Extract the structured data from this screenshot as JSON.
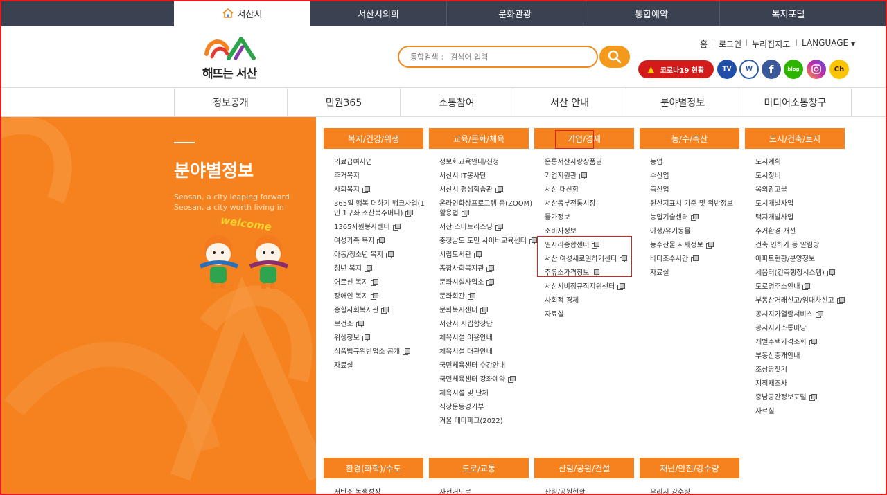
{
  "top_tabs": [
    "서산시",
    "서산시의회",
    "문화관광",
    "통합예약",
    "복지포털"
  ],
  "logo": {
    "text": "해뜨는 서산"
  },
  "search": {
    "label": "통합검색",
    "placeholder": "검색어 입력"
  },
  "utility_links": [
    "홈",
    "로그인",
    "누리집지도",
    "LANGUAGE"
  ],
  "corona_badge": "코로나19 현황",
  "sns": [
    {
      "name": "서산시TV",
      "color": "#1f4fa8"
    },
    {
      "name": "서산시 블로그웹진",
      "color": "#2a5caa"
    },
    {
      "name": "facebook",
      "color": "#3b5998"
    },
    {
      "name": "blog",
      "color": "#2db400"
    },
    {
      "name": "instagram",
      "color": "#c32aa3"
    },
    {
      "name": "kakao channel",
      "color": "#fbc400"
    }
  ],
  "main_nav": [
    "정보공개",
    "민원365",
    "소통참여",
    "서산 안내",
    "분야별정보",
    "미디어소통창구"
  ],
  "left_panel": {
    "title": "분야별정보",
    "sub1": "Seosan, a city leaping forward",
    "sub2": "Seosan, a city worth living in",
    "welcome": "welcome"
  },
  "columns": [
    {
      "title": "복지/건강/위생",
      "items": [
        {
          "t": "의료급여사업",
          "e": false
        },
        {
          "t": "주거복지",
          "e": false
        },
        {
          "t": "사회복지",
          "e": true
        },
        {
          "t": "365일 행복 더하기 뱅크사업(1인 1구좌 소산복주머니)",
          "e": true
        },
        {
          "t": "1365자원봉사센터",
          "e": true
        },
        {
          "t": "여성가족 복지",
          "e": true
        },
        {
          "t": "아동/청소년 복지",
          "e": true
        },
        {
          "t": "청년 복지",
          "e": true
        },
        {
          "t": "어르신 복지",
          "e": true
        },
        {
          "t": "장애인 복지",
          "e": true
        },
        {
          "t": "종합사회복지관",
          "e": true
        },
        {
          "t": "보건소",
          "e": true
        },
        {
          "t": "위생정보",
          "e": true
        },
        {
          "t": "식품법규위반업소 공개",
          "e": true
        },
        {
          "t": "자료실",
          "e": false
        }
      ]
    },
    {
      "title": "교육/문화/체육",
      "items": [
        {
          "t": "정보화교육안내/신청",
          "e": false
        },
        {
          "t": "서산시 IT봉사단",
          "e": false
        },
        {
          "t": "서산시 평생학습관",
          "e": true
        },
        {
          "t": "온라인화상프로그램 줌(ZOOM)활용법",
          "e": true
        },
        {
          "t": "서산 스마트리스닝",
          "e": true
        },
        {
          "t": "충청남도 도민 사이버교육센터",
          "e": true
        },
        {
          "t": "시립도서관",
          "e": true
        },
        {
          "t": "종합사회복지관",
          "e": true
        },
        {
          "t": "문화시설사업소",
          "e": true
        },
        {
          "t": "문화회관",
          "e": true
        },
        {
          "t": "문화복지센터",
          "e": true
        },
        {
          "t": "서산시 시립합창단",
          "e": false
        },
        {
          "t": "체육시설 이용안내",
          "e": false
        },
        {
          "t": "체육시설 대관안내",
          "e": false
        },
        {
          "t": "국민체육센터 수강안내",
          "e": false
        },
        {
          "t": "국민체육센터 강좌예약",
          "e": true
        },
        {
          "t": "체육시설 및 단체",
          "e": false
        },
        {
          "t": "직장운동경기부",
          "e": false
        },
        {
          "t": "겨울 테마파크(2022)",
          "e": false
        }
      ]
    },
    {
      "title": "기업/경제",
      "items": [
        {
          "t": "온통서산사랑상품권",
          "e": false
        },
        {
          "t": "기업지원관",
          "e": true
        },
        {
          "t": "서산 대산항",
          "e": false
        },
        {
          "t": "서산동부전통시장",
          "e": false
        },
        {
          "t": "물가정보",
          "e": false
        },
        {
          "t": "소비자정보",
          "e": false
        },
        {
          "t": "일자리종합센터",
          "e": true
        },
        {
          "t": "서산 여성새로일하기센터",
          "e": true
        },
        {
          "t": "주유소가격정보",
          "e": true
        },
        {
          "t": "서산시비정규직지원센터",
          "e": true
        },
        {
          "t": "사회적 경제",
          "e": false
        },
        {
          "t": "자료실",
          "e": false
        }
      ]
    },
    {
      "title": "농/수/축산",
      "items": [
        {
          "t": "농업",
          "e": false
        },
        {
          "t": "수산업",
          "e": false
        },
        {
          "t": "축산업",
          "e": false
        },
        {
          "t": "원산지표시 기준 및 위반정보",
          "e": false
        },
        {
          "t": "농업기술센터",
          "e": true
        },
        {
          "t": "야생/유기동물",
          "e": false
        },
        {
          "t": "농수산물 시세정보",
          "e": true
        },
        {
          "t": "바다조수시간",
          "e": true
        },
        {
          "t": "자료실",
          "e": false
        }
      ]
    },
    {
      "title": "도시/건축/토지",
      "items": [
        {
          "t": "도시계획",
          "e": false
        },
        {
          "t": "도시정비",
          "e": false
        },
        {
          "t": "옥외광고물",
          "e": false
        },
        {
          "t": "도시개발사업",
          "e": false
        },
        {
          "t": "택지개발사업",
          "e": false
        },
        {
          "t": "주거환경 개선",
          "e": false
        },
        {
          "t": "건축 인허가 등 알림방",
          "e": false
        },
        {
          "t": "아파트현황/분양정보",
          "e": false
        },
        {
          "t": "세움터(건축행정시스템)",
          "e": true
        },
        {
          "t": "도로명주소안내",
          "e": true
        },
        {
          "t": "부동산거래신고/임대차신고",
          "e": true
        },
        {
          "t": "공시지가열람서비스",
          "e": true
        },
        {
          "t": "공시지가소통마당",
          "e": false
        },
        {
          "t": "개별주택가격조회",
          "e": true
        },
        {
          "t": "부동산중개안내",
          "e": false
        },
        {
          "t": "조상땅찾기",
          "e": false
        },
        {
          "t": "지적재조사",
          "e": false
        },
        {
          "t": "중남공간정보포털",
          "e": true
        },
        {
          "t": "자료실",
          "e": false
        }
      ]
    }
  ],
  "bottom_columns": [
    {
      "title": "환경(화학)/수도",
      "first": "저탄소 녹색성장"
    },
    {
      "title": "도로/교통",
      "first": "자전거도로"
    },
    {
      "title": "산림/공원/건설",
      "first": "산림/공원현황"
    },
    {
      "title": "재난/안전/강수량",
      "first": "우리시 강수량"
    }
  ]
}
